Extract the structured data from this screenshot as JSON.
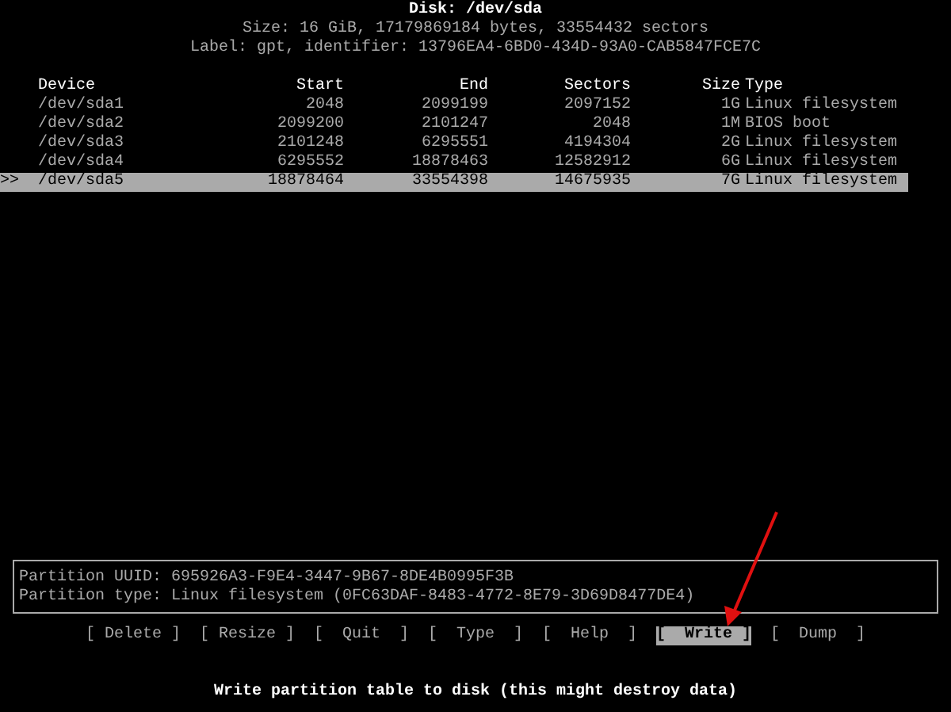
{
  "header": {
    "title": "Disk: /dev/sda",
    "size": "Size: 16 GiB, 17179869184 bytes, 33554432 sectors",
    "label": "Label: gpt, identifier: 13796EA4-6BD0-434D-93A0-CAB5847FCE7C"
  },
  "table": {
    "columns": [
      "Device",
      "Start",
      "End",
      "Sectors",
      "Size",
      "Type"
    ],
    "cursor": ">>",
    "rows": [
      {
        "device": "/dev/sda1",
        "start": "2048",
        "end": "2099199",
        "sectors": "2097152",
        "size": "1G",
        "type": "Linux filesystem",
        "selected": false
      },
      {
        "device": "/dev/sda2",
        "start": "2099200",
        "end": "2101247",
        "sectors": "2048",
        "size": "1M",
        "type": "BIOS boot",
        "selected": false
      },
      {
        "device": "/dev/sda3",
        "start": "2101248",
        "end": "6295551",
        "sectors": "4194304",
        "size": "2G",
        "type": "Linux filesystem",
        "selected": false
      },
      {
        "device": "/dev/sda4",
        "start": "6295552",
        "end": "18878463",
        "sectors": "12582912",
        "size": "6G",
        "type": "Linux filesystem",
        "selected": false
      },
      {
        "device": "/dev/sda5",
        "start": "18878464",
        "end": "33554398",
        "sectors": "14675935",
        "size": "7G",
        "type": "Linux filesystem",
        "selected": true
      }
    ]
  },
  "info": [
    "Partition UUID: 695926A3-F9E4-3447-9B67-8DE4B0995F3B",
    "Partition type: Linux filesystem (0FC63DAF-8483-4772-8E79-3D69D8477DE4)"
  ],
  "buttons": [
    {
      "label": "[ Delete ]",
      "selected": false
    },
    {
      "label": "[ Resize ]",
      "selected": false
    },
    {
      "label": "[  Quit  ]",
      "selected": false
    },
    {
      "label": "[  Type  ]",
      "selected": false
    },
    {
      "label": "[  Help  ]",
      "selected": false
    },
    {
      "label": "[  Write ]",
      "selected": true
    },
    {
      "label": "[  Dump  ]",
      "selected": false
    }
  ],
  "hint": "Write partition table to disk (this might destroy data)"
}
